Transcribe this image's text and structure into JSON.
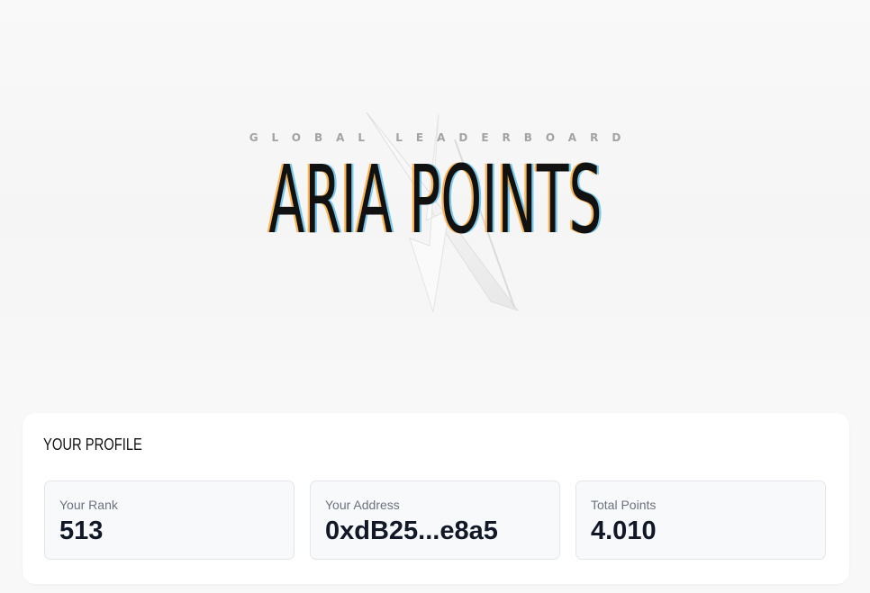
{
  "hero": {
    "eyebrow": "GLOBAL LEADERBOARD",
    "title": "ARIA POINTS",
    "graphic_icon": "lightning-shard-icon"
  },
  "profile": {
    "title": "YOUR PROFILE",
    "stats": [
      {
        "label": "Your Rank",
        "value": "513"
      },
      {
        "label": "Your Address",
        "value": "0xdB25...e8a5"
      },
      {
        "label": "Total Points",
        "value": "4.010"
      }
    ]
  },
  "colors": {
    "page_background": "#f8f8f8",
    "card_background": "#ffffff",
    "stat_background": "#f8f9fb",
    "stat_border": "#e3e6ea",
    "title_text": "#111111",
    "glitch_orange": "#ff9f1c",
    "glitch_blue": "#28aae6",
    "muted_text": "#6b7280"
  }
}
